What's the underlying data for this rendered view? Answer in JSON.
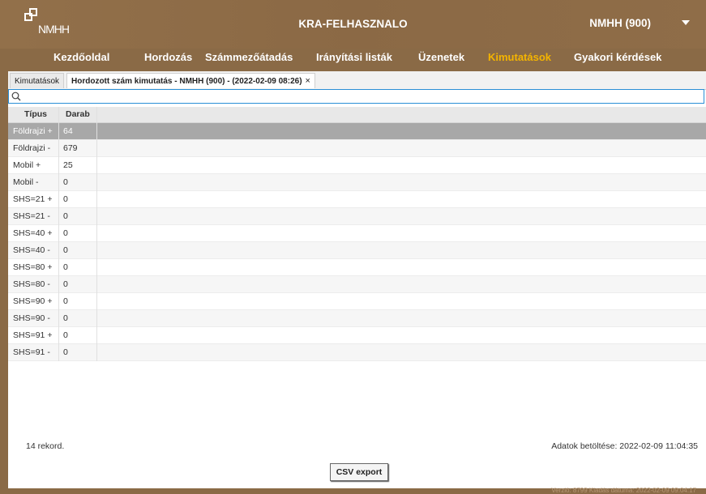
{
  "header": {
    "logo_text": "NMHH",
    "app_title": "KRA-FELHASZNALO",
    "user": "NMHH (900)"
  },
  "nav": {
    "items": [
      {
        "label": "Kezdőoldal"
      },
      {
        "label": "Hordozás"
      },
      {
        "label": "Számmezőátadás"
      },
      {
        "label": "Irányítási listák"
      },
      {
        "label": "Üzenetek"
      },
      {
        "label": "Kimutatások"
      },
      {
        "label": "Gyakori kérdések"
      }
    ],
    "active_index": 5
  },
  "tabs": {
    "items": [
      {
        "label": "Kimutatások"
      },
      {
        "label": "Hordozott szám kimutatás - NMHH (900) - (2022-02-09 08:26)",
        "close": "×"
      }
    ]
  },
  "search": {
    "value": "",
    "placeholder": ""
  },
  "table": {
    "headers": [
      "Típus",
      "Darab"
    ],
    "rows": [
      {
        "type": "Földrajzi +",
        "count": "64"
      },
      {
        "type": "Földrajzi -",
        "count": "679"
      },
      {
        "type": "Mobil +",
        "count": "25"
      },
      {
        "type": "Mobil -",
        "count": "0"
      },
      {
        "type": "SHS=21 +",
        "count": "0"
      },
      {
        "type": "SHS=21 -",
        "count": "0"
      },
      {
        "type": "SHS=40 +",
        "count": "0"
      },
      {
        "type": "SHS=40 -",
        "count": "0"
      },
      {
        "type": "SHS=80 +",
        "count": "0"
      },
      {
        "type": "SHS=80 -",
        "count": "0"
      },
      {
        "type": "SHS=90 +",
        "count": "0"
      },
      {
        "type": "SHS=90 -",
        "count": "0"
      },
      {
        "type": "SHS=91 +",
        "count": "0"
      },
      {
        "type": "SHS=91 -",
        "count": "0"
      }
    ],
    "selected_index": 0
  },
  "footer": {
    "record_count": "14 rekord.",
    "loaded": "Adatok betöltése: 2022-02-09 11:04:35",
    "csv_button": "CSV export",
    "version": "Verzió: 8799 Kiadás dátuma: 2022-02-09 09:04:17"
  },
  "colors": {
    "header_bg": "#8e6c47",
    "active_nav": "#f4b400",
    "selected_row": "#a8a8a8",
    "search_border": "#2a8fd6"
  }
}
